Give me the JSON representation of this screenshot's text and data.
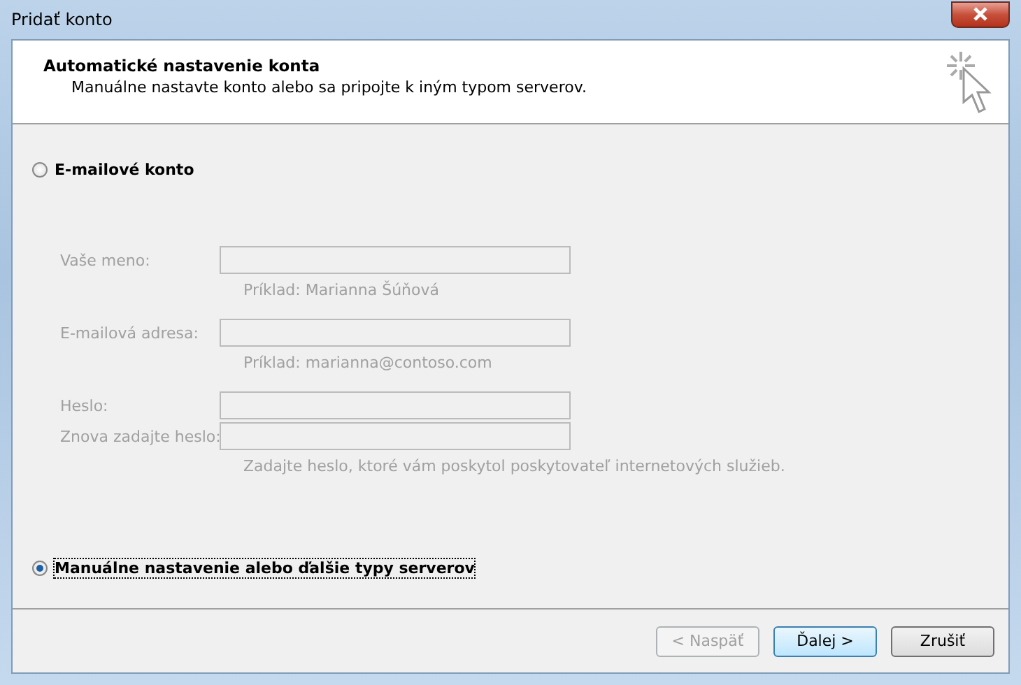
{
  "window": {
    "title": "Pridať konto"
  },
  "header": {
    "title": "Automatické nastavenie konta",
    "subtitle": "Manuálne nastavte konto alebo sa pripojte k iným typom serverov."
  },
  "account_types": [
    {
      "label": "E-mailové konto",
      "selected": false
    },
    {
      "label": "Manuálne nastavenie alebo ďalšie typy serverov",
      "selected": true
    }
  ],
  "fields": [
    {
      "label": "Vaše meno:",
      "hint": "Príklad: Marianna Šúňová",
      "disabled": true
    },
    {
      "label": "E-mailová adresa:",
      "hint": "Príklad: marianna@contoso.com",
      "disabled": true
    },
    {
      "label": "Heslo:",
      "disabled": true
    },
    {
      "label": "Znova zadajte heslo:",
      "hint": "Zadajte heslo, ktoré vám poskytol poskytovateľ internetových služieb.",
      "disabled": true
    }
  ],
  "buttons": [
    {
      "label": "< Naspäť",
      "disabled": true,
      "default": false
    },
    {
      "label": "Ďalej >",
      "disabled": false,
      "default": true
    },
    {
      "label": "Zrušiť",
      "disabled": false,
      "default": false
    }
  ]
}
